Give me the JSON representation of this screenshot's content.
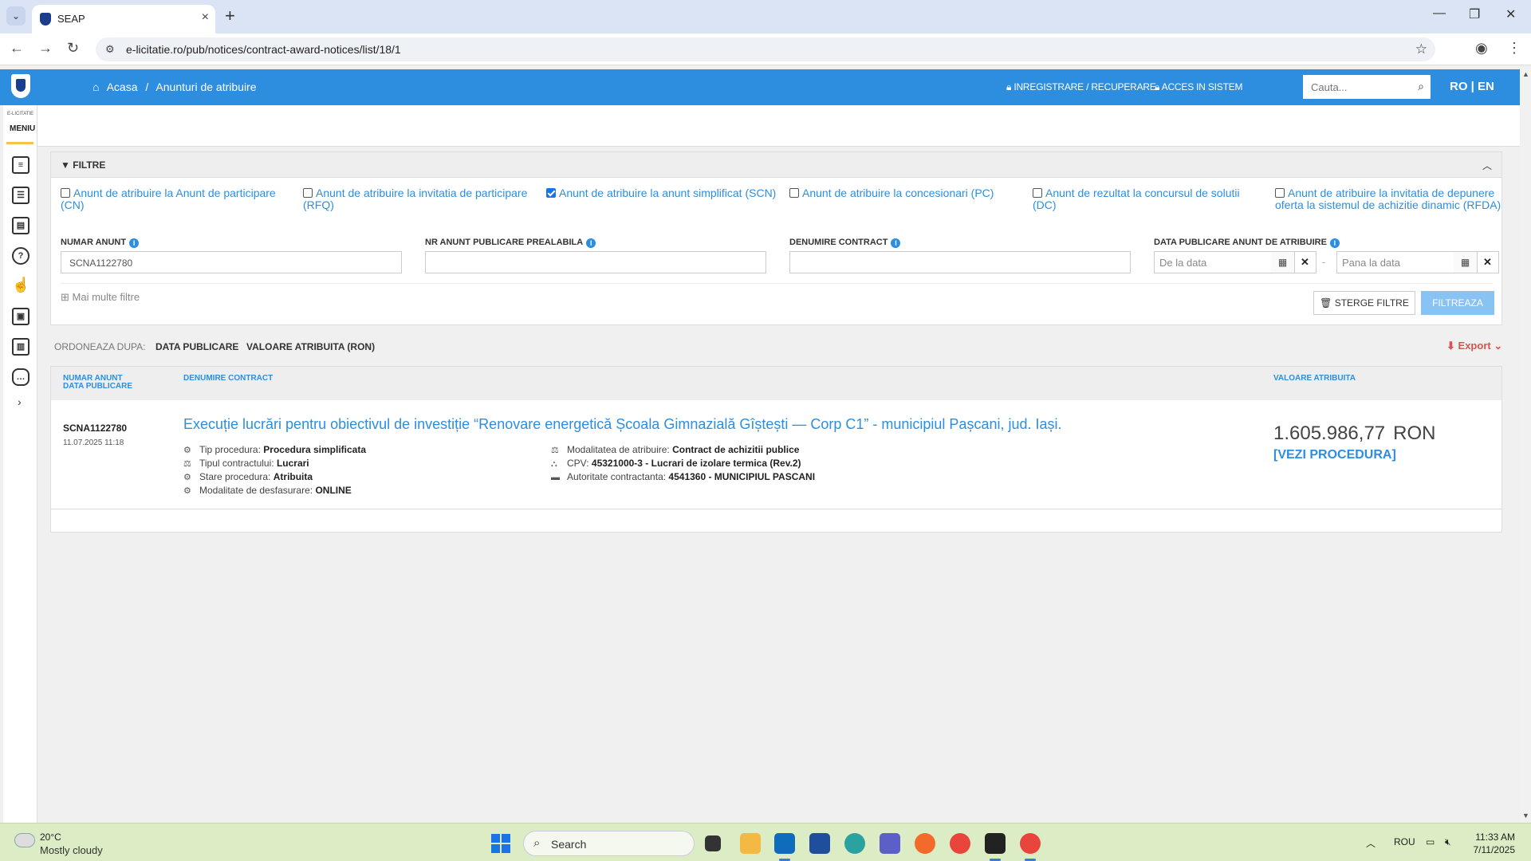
{
  "browser": {
    "tab_title": "SEAP",
    "url": "e-licitatie.ro/pub/notices/contract-award-notices/list/18/1"
  },
  "header": {
    "home": "Acasa",
    "separator": "/",
    "current": "Anunturi de atribuire",
    "register_link": "INREGISTRARE / RECUPERARE",
    "login_link": "ACCES IN SISTEM",
    "search_placeholder": "Cauta...",
    "lang": "RO | EN"
  },
  "left_menu": {
    "small_label": "E-LICITATIE",
    "label": "MENIU",
    "icons": [
      "notices-icon",
      "list-icon",
      "documents-icon",
      "help-icon",
      "settings-hand-icon",
      "contact-card-icon",
      "library-icon",
      "chat-icon"
    ]
  },
  "filters": {
    "title": "FILTRE",
    "types": [
      {
        "label": "Anunt de atribuire la Anunt de participare (CN)",
        "checked": false
      },
      {
        "label": "Anunt de atribuire la invitatia de participare (RFQ)",
        "checked": false
      },
      {
        "label": "Anunt de atribuire la anunt simplificat (SCN)",
        "checked": true
      },
      {
        "label": "Anunt de atribuire la concesionari (PC)",
        "checked": false
      },
      {
        "label": "Anunt de rezultat la concursul de solutii (DC)",
        "checked": false
      },
      {
        "label": "Anunt de atribuire la invitatia de depunere oferta la sistemul de achizitie dinamic (RFDA)",
        "checked": false
      }
    ],
    "fields": {
      "numar_anunt_label": "NUMAR ANUNT",
      "numar_anunt_value": "SCNA1122780",
      "nr_prealabil_label": "NR ANUNT PUBLICARE PREALABILA",
      "denumire_label": "DENUMIRE CONTRACT",
      "data_label": "DATA PUBLICARE ANUNT DE ATRIBUIRE",
      "from_placeholder": "De la data",
      "to_placeholder": "Pana la data"
    },
    "more_filters": "Mai multe filtre",
    "clear_button": "STERGE FILTRE",
    "filter_button": "FILTREAZA"
  },
  "sort": {
    "label": "ORDONEAZA DUPA:",
    "option1": "DATA PUBLICARE",
    "option2": "VALOARE ATRIBUITA (RON)",
    "export": "Export"
  },
  "results": {
    "columns": {
      "col1_line1": "NUMAR ANUNT",
      "col1_line2": "DATA PUBLICARE",
      "col2": "DENUMIRE CONTRACT",
      "col3": "VALOARE ATRIBUITA"
    },
    "rows": [
      {
        "numar": "SCNA1122780",
        "data": "11.07.2025 11:18",
        "title": "Execuție lucrări pentru obiectivul de investiție “Renovare energetică Școala Gimnazială Gîștești — Corp C1” - municipiul Pașcani, jud. Iași.",
        "tip_procedura_label": "Tip procedura:",
        "tip_procedura": "Procedura simplificata",
        "tip_contract_label": "Tipul contractului:",
        "tip_contract": "Lucrari",
        "stare_label": "Stare procedura:",
        "stare": "Atribuita",
        "modalitate_desf_label": "Modalitate de desfasurare:",
        "modalitate_desf": "ONLINE",
        "modalitate_atr_label": "Modalitatea de atribuire:",
        "modalitate_atr": "Contract de achizitii publice",
        "cpv_label": "CPV:",
        "cpv": "45321000-3 - Lucrari de izolare termica (Rev.2)",
        "autoritate_label": "Autoritate contractanta:",
        "autoritate": "4541360 - MUNICIPIUL PASCANI",
        "valoare": "1.605.986,77",
        "moneda": "RON",
        "vezi": "[VEZI PROCEDURA]"
      }
    ]
  },
  "taskbar": {
    "temp": "20°C",
    "weather": "Mostly cloudy",
    "search": "Search",
    "lang": "ROU",
    "time": "11:33 AM",
    "date": "7/11/2025"
  }
}
